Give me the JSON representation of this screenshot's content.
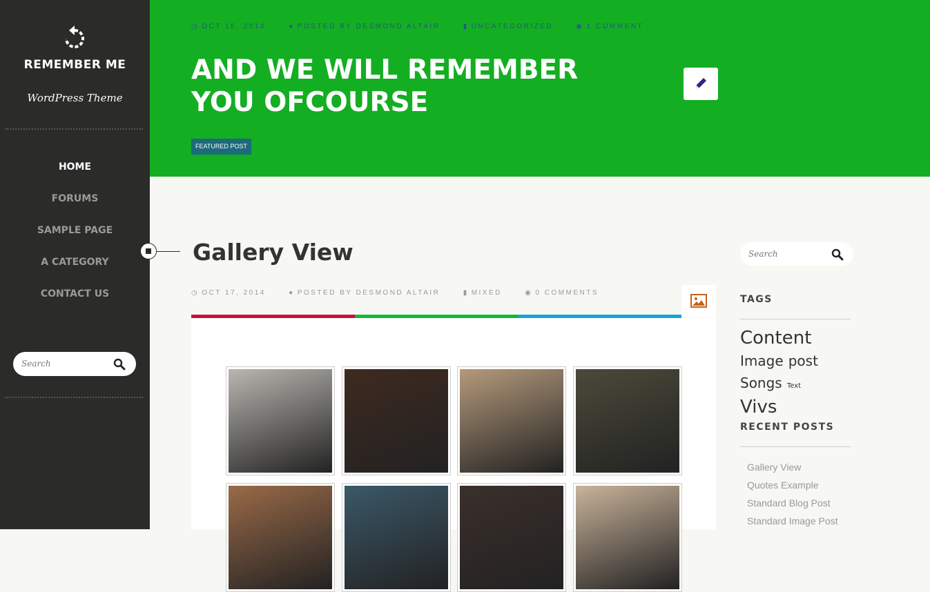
{
  "sidebar": {
    "site_title": "REMEMBER ME",
    "tagline": "WordPress Theme",
    "nav": [
      "HOME",
      "FORUMS",
      "SAMPLE PAGE",
      "A CATEGORY",
      "CONTACT US"
    ],
    "search_placeholder": "Search"
  },
  "header": {
    "meta": {
      "date": "OCT 16, 2014",
      "author": "POSTED BY DESMOND ALTAIR",
      "category": "UNCATEGORIZED",
      "comments": "1 COMMENT"
    },
    "title": "AND WE WILL REMEMBER YOU OFCOURSE",
    "badge": "FEATURED POST",
    "bg_color": "#14ae22"
  },
  "post": {
    "title": "Gallery View",
    "meta": {
      "date": "OCT 17, 2014",
      "author": "POSTED BY DESMOND ALTAIR",
      "category": "MIXED",
      "comments": "0 COMMENTS"
    },
    "bar_colors": [
      "#c8103e",
      "#10b83c",
      "#12a6d6"
    ],
    "gallery": [
      {
        "name": "gallery-image-1",
        "color": "#b9b6b0"
      },
      {
        "name": "gallery-image-2",
        "color": "#3e2a20"
      },
      {
        "name": "gallery-image-3",
        "color": "#b59a7c"
      },
      {
        "name": "gallery-image-4",
        "color": "#4a4a3a"
      },
      {
        "name": "gallery-image-5",
        "color": "#9a6a48"
      },
      {
        "name": "gallery-image-6",
        "color": "#3b5868"
      },
      {
        "name": "gallery-image-7",
        "color": "#3b2f2b"
      },
      {
        "name": "gallery-image-8",
        "color": "#c9b39a"
      }
    ]
  },
  "right_sidebar": {
    "search_placeholder": "Search",
    "tags_title": "TAGS",
    "tags": [
      "Content",
      "Image",
      "post",
      "Songs",
      "Text",
      "Vivs"
    ],
    "recent_title": "RECENT POSTS",
    "recent_posts": [
      "Gallery View",
      "Quotes Example",
      "Standard Blog Post",
      "Standard Image Post"
    ]
  }
}
